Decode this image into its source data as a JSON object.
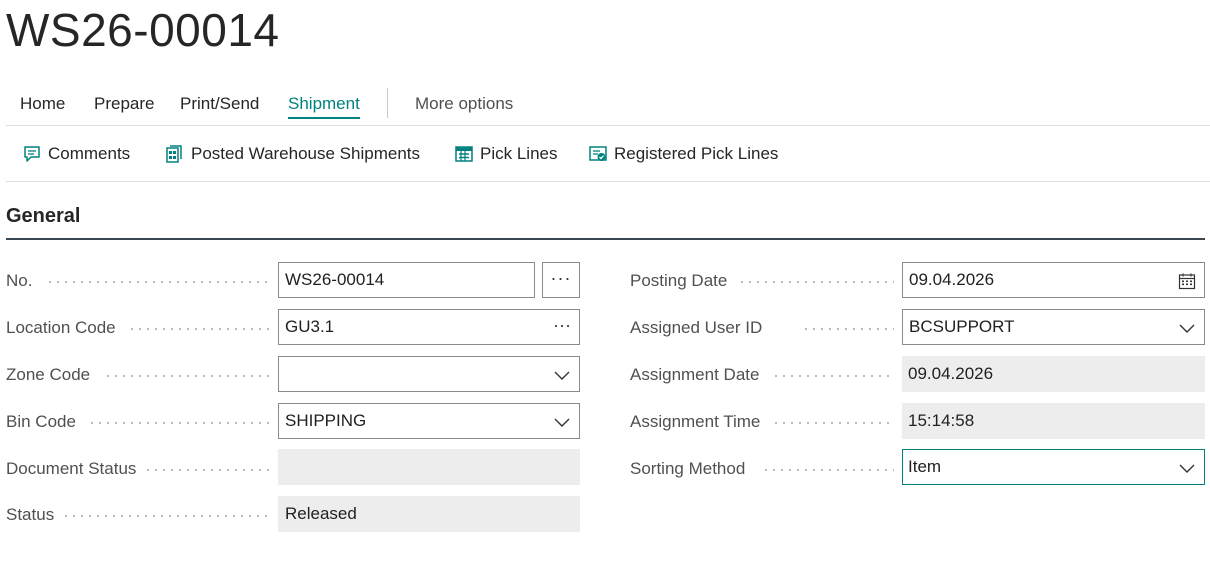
{
  "page": {
    "title": "WS26-00014"
  },
  "tabs": [
    {
      "label": "Home"
    },
    {
      "label": "Prepare"
    },
    {
      "label": "Print/Send"
    },
    {
      "label": "Shipment",
      "active": true
    },
    {
      "label": "More options"
    }
  ],
  "actions": [
    {
      "label": "Comments",
      "icon": "comment-icon"
    },
    {
      "label": "Posted Warehouse Shipments",
      "icon": "posted-shipments-icon"
    },
    {
      "label": "Pick Lines",
      "icon": "pick-lines-icon"
    },
    {
      "label": "Registered Pick Lines",
      "icon": "registered-pick-lines-icon"
    }
  ],
  "section": {
    "title": "General"
  },
  "fields_left": [
    {
      "label": "No.",
      "value": "WS26-00014",
      "control": "text-with-lookup-button"
    },
    {
      "label": "Location Code",
      "value": "GU3.1",
      "control": "text-with-inline-lookup"
    },
    {
      "label": "Zone Code",
      "value": "",
      "control": "dropdown"
    },
    {
      "label": "Bin Code",
      "value": "SHIPPING",
      "control": "dropdown"
    },
    {
      "label": "Document Status",
      "value": "",
      "control": "readonly"
    },
    {
      "label": "Status",
      "value": "Released",
      "control": "readonly"
    }
  ],
  "fields_right": [
    {
      "label": "Posting Date",
      "value": "09.04.2026",
      "control": "date"
    },
    {
      "label": "Assigned User ID",
      "value": "BCSUPPORT",
      "control": "dropdown"
    },
    {
      "label": "Assignment Date",
      "value": "09.04.2026",
      "control": "readonly"
    },
    {
      "label": "Assignment Time",
      "value": "15:14:58",
      "control": "readonly"
    },
    {
      "label": "Sorting Method",
      "value": "Item",
      "control": "dropdown-focused"
    }
  ],
  "buttons": {
    "lookup_ellipsis": "···",
    "inline_ellipsis": "···"
  },
  "colors": {
    "accent": "#00827f",
    "readonly_bg": "#ededed",
    "border": "#8a8a8a"
  }
}
